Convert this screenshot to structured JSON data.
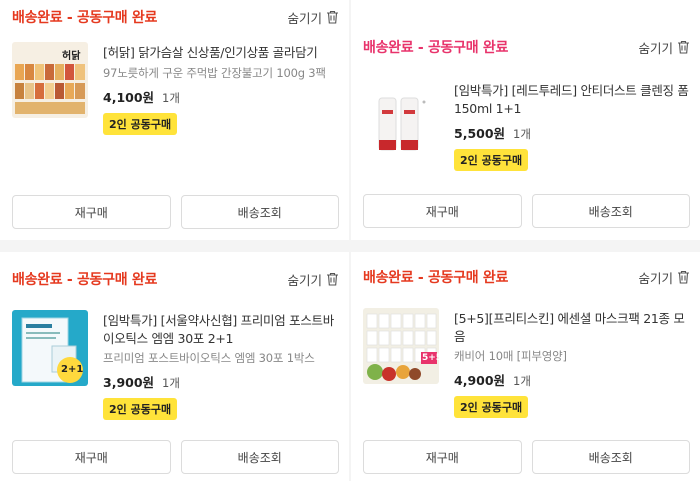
{
  "orders": [
    {
      "status": "배송완료 - 공동구매 완료",
      "hide_label": "숨기기",
      "title": "[허닭] 닭가슴살 신상품/인기상품 골라담기",
      "subtitle": "97노릇하게 구운 주먹밥 간장불고기 100g 3팩",
      "price": "4,100원",
      "qty": "1개",
      "badge": "2인 공동구매",
      "thumb_logo": "허닭",
      "reorder_label": "재구매",
      "track_label": "배송조회"
    },
    {
      "status": "배송완료 - 공동구매 완료",
      "hide_label": "숨기기",
      "title": "[임박특가] [레드투레드] 안티더스트 클렌징 폼 150ml 1+1",
      "subtitle": "",
      "price": "5,500원",
      "qty": "1개",
      "badge": "2인 공동구매",
      "reorder_label": "재구매",
      "track_label": "배송조회"
    },
    {
      "status": "배송완료 - 공동구매 완료",
      "hide_label": "숨기기",
      "title": "[임박특가] [서울약사신협] 프리미엄 포스트바이오틱스 엠엠 30포 2+1",
      "subtitle": "프리미엄 포스트바이오틱스 엠엠 30포 1박스",
      "price": "3,900원",
      "qty": "1개",
      "badge": "2인 공동구매",
      "thumb_tag": "2+1",
      "reorder_label": "재구매",
      "track_label": "배송조회"
    },
    {
      "status": "배송완료 - 공동구매 완료",
      "hide_label": "숨기기",
      "title": "[5+5][프리티스킨] 에센셜 마스크팩 21종 모음",
      "subtitle": "캐비어 10매 [피부영양]",
      "price": "4,900원",
      "qty": "1개",
      "badge": "2인 공동구매",
      "thumb_tag": "5+5",
      "reorder_label": "재구매",
      "track_label": "배송조회"
    }
  ],
  "colors": {
    "status_red": "#e5391f",
    "status_pink": "#e8336b",
    "badge_yellow": "#ffe33a"
  },
  "icons": [
    "trash-icon"
  ]
}
